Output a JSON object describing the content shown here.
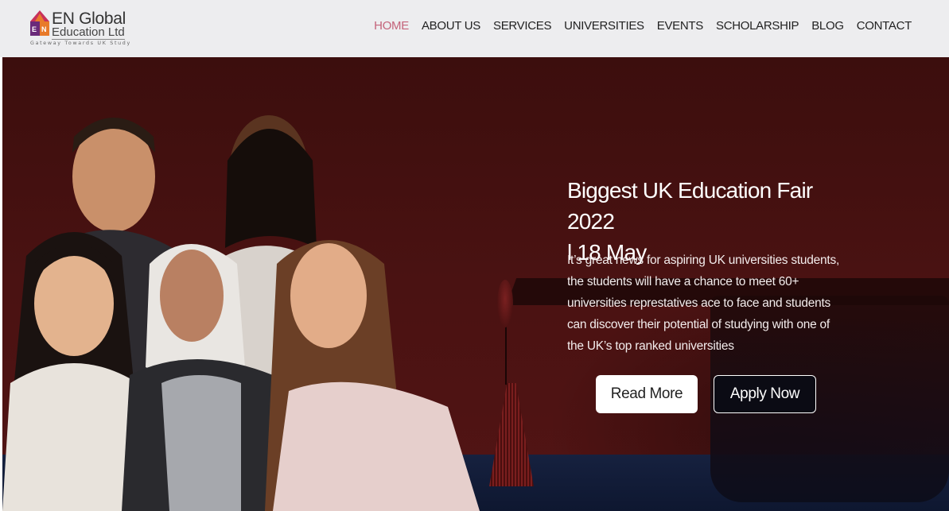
{
  "brand": {
    "logo_letters": "EN",
    "title": "EN Global",
    "subtitle": "Education Ltd",
    "tagline": "Gateway Towards UK Study",
    "colors": {
      "mark_top": "#c8315a",
      "mark_left": "#6a2a7a",
      "mark_right": "#e87a2a"
    }
  },
  "nav": {
    "items": [
      {
        "label": "HOME",
        "active": true
      },
      {
        "label": "ABOUT US"
      },
      {
        "label": "SERVICES"
      },
      {
        "label": "UNIVERSITIES"
      },
      {
        "label": "EVENTS"
      },
      {
        "label": "SCHOLARSHIP"
      },
      {
        "label": "BLOG"
      },
      {
        "label": "CONTACT"
      }
    ],
    "active_color": "#c4637a"
  },
  "hero": {
    "title_line1": "Biggest UK Education Fair 2022",
    "title_line2": "l 18 May",
    "text": "It’s great news for aspiring UK universities students, the students will have a chance to meet 60+ universities represtatives ace to face and students can discover their potential of studying with one of the UK’s top ranked universities",
    "read_more_label": "Read More",
    "apply_now_label": "Apply Now",
    "photo": "group-of-students-image"
  }
}
